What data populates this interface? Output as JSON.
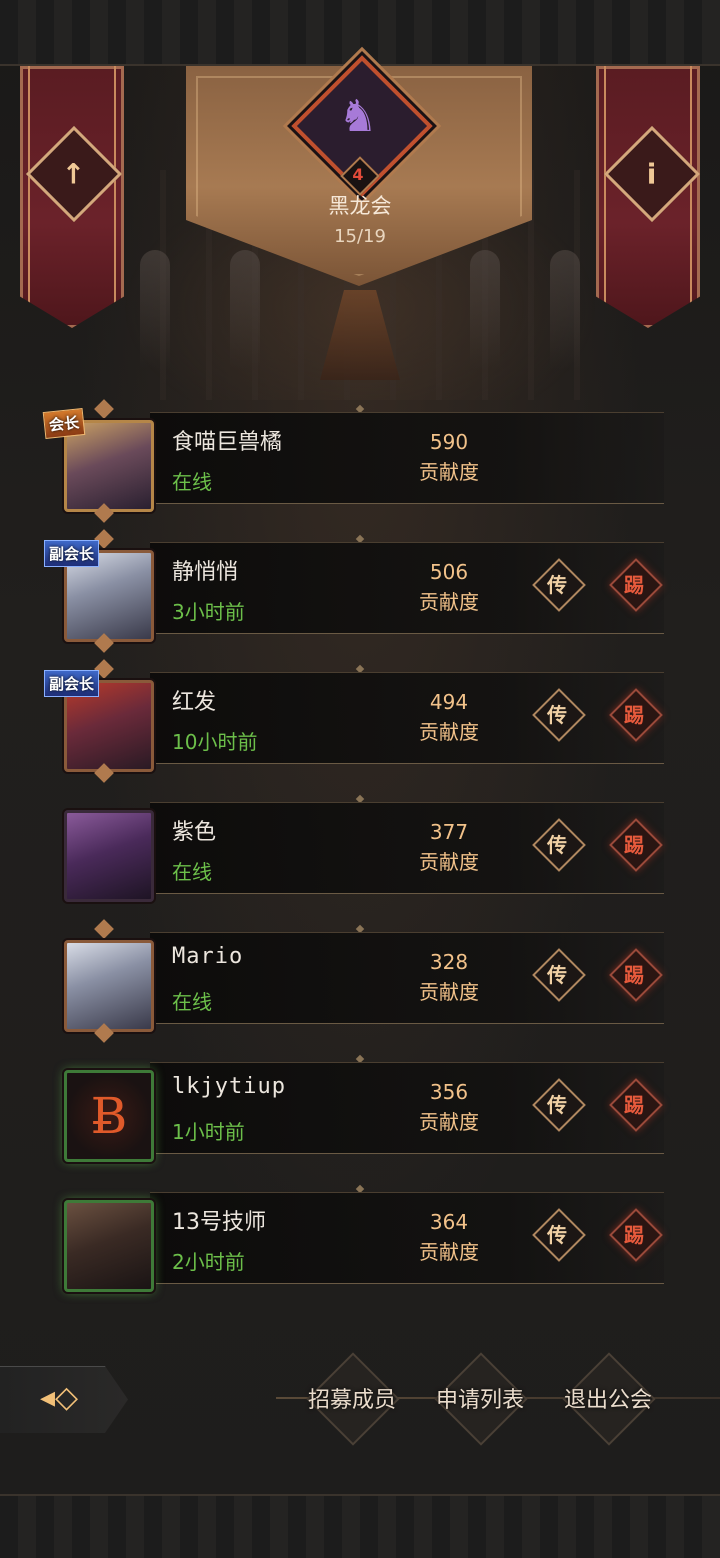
{
  "guild": {
    "name": "黑龙会",
    "level": "4",
    "member_count": "15/19"
  },
  "banners": {
    "left_icon": "up-arrow-icon",
    "right_icon": "info-icon"
  },
  "members": [
    {
      "name": "食喵巨兽橘",
      "status": "在线",
      "contribution": "590",
      "contribution_label": "贡献度",
      "role": "会长"
    },
    {
      "name": "静悄悄",
      "status": "3小时前",
      "contribution": "506",
      "contribution_label": "贡献度",
      "role": "副会长",
      "transfer_label": "传",
      "kick_label": "踢"
    },
    {
      "name": "红发",
      "status": "10小时前",
      "contribution": "494",
      "contribution_label": "贡献度",
      "role": "副会长",
      "transfer_label": "传",
      "kick_label": "踢"
    },
    {
      "name": "紫色",
      "status": "在线",
      "contribution": "377",
      "contribution_label": "贡献度",
      "transfer_label": "传",
      "kick_label": "踢"
    },
    {
      "name": "Mario",
      "status": "在线",
      "contribution": "328",
      "contribution_label": "贡献度",
      "transfer_label": "传",
      "kick_label": "踢"
    },
    {
      "name": "lkjytiup",
      "status": "1小时前",
      "contribution": "356",
      "contribution_label": "贡献度",
      "transfer_label": "传",
      "kick_label": "踢"
    },
    {
      "name": "13号技师",
      "status": "2小时前",
      "contribution": "364",
      "contribution_label": "贡献度",
      "transfer_label": "传",
      "kick_label": "踢"
    }
  ],
  "bottom_nav": {
    "recruit": "招募成员",
    "applications": "申请列表",
    "leave": "退出公会"
  },
  "colors": {
    "online_status": "#6cbf4a",
    "contribution": "#f2c28a",
    "kick": "#e75a3c",
    "banner": "#6b222a"
  }
}
